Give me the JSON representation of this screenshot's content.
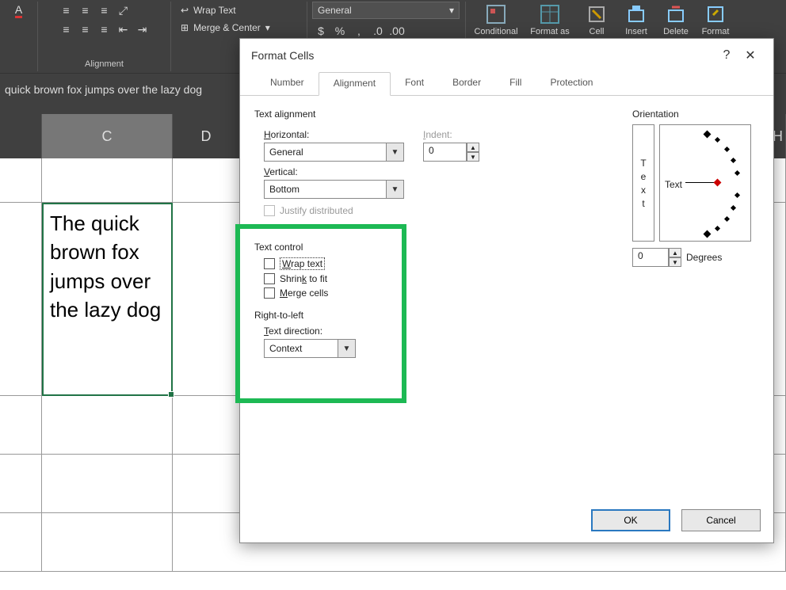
{
  "ribbon": {
    "wrap_text": "Wrap Text",
    "merge_center": "Merge & Center",
    "alignment_label": "Alignment",
    "general": "General",
    "conditional": "Conditional",
    "format_as": "Format as",
    "cell": "Cell",
    "insert": "Insert",
    "delete": "Delete",
    "format": "Format"
  },
  "formula_bar": {
    "content": "quick brown fox jumps over the lazy dog"
  },
  "columns": {
    "c": "C",
    "d": "D",
    "h": "H"
  },
  "cell": {
    "value": "The quick brown fox jumps over the lazy dog"
  },
  "dialog": {
    "title": "Format Cells",
    "help": "?",
    "close": "✕",
    "tabs": {
      "number": "Number",
      "alignment": "Alignment",
      "font": "Font",
      "border": "Border",
      "fill": "Fill",
      "protection": "Protection"
    },
    "text_alignment": "Text alignment",
    "horizontal_label": "Horizontal:",
    "horizontal_value": "General",
    "indent_label": "Indent:",
    "indent_value": "0",
    "vertical_label": "Vertical:",
    "vertical_value": "Bottom",
    "justify_dist": "Justify distributed",
    "text_control": "Text control",
    "wrap_text": "Wrap text",
    "shrink_to_fit": "Shrink to fit",
    "merge_cells": "Merge cells",
    "rtl": "Right-to-left",
    "text_direction": "Text direction:",
    "text_direction_value": "Context",
    "orientation": "Orientation",
    "orient_text": "Text",
    "degrees_value": "0",
    "degrees_label": "Degrees",
    "vert_t": "T",
    "vert_e": "e",
    "vert_x": "x",
    "vert_t2": "t",
    "ok": "OK",
    "cancel": "Cancel"
  }
}
